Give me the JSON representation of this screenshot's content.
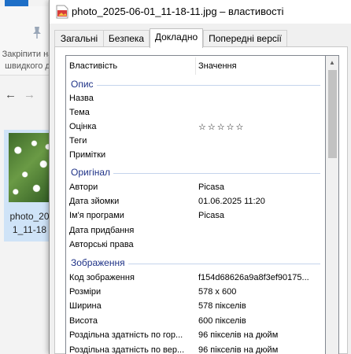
{
  "explorer": {
    "pin_text_line1": "Закріпити на",
    "pin_text_line2": "швидкого д",
    "back_arrow": "←",
    "forward_arrow": "→",
    "thumb_name_line1": "photo_20",
    "thumb_name_line2": "1_11-18"
  },
  "dialog": {
    "title": "photo_2025-06-01_11-18-11.jpg – властивості",
    "tabs": [
      {
        "label": "Загальні"
      },
      {
        "label": "Безпека"
      },
      {
        "label": "Докладно"
      },
      {
        "label": "Попередні версії"
      }
    ],
    "columns": {
      "property": "Властивість",
      "value": "Значення"
    },
    "groups": {
      "description": "Опис",
      "origin": "Оригінал",
      "image": "Зображення"
    },
    "description_rows": [
      {
        "key": "Назва",
        "value": ""
      },
      {
        "key": "Тема",
        "value": ""
      },
      {
        "key": "Оцінка",
        "value": "☆☆☆☆☆"
      },
      {
        "key": "Теги",
        "value": ""
      },
      {
        "key": "Примітки",
        "value": ""
      }
    ],
    "origin_rows": [
      {
        "key": "Автори",
        "value": "Picasa"
      },
      {
        "key": "Дата зйомки",
        "value": "01.06.2025 11:20"
      },
      {
        "key": "Ім'я програми",
        "value": "Picasa"
      },
      {
        "key": "Дата придбання",
        "value": ""
      },
      {
        "key": "Авторські права",
        "value": ""
      }
    ],
    "image_rows": [
      {
        "key": "Код зображення",
        "value": "f154d68626a9a8f3ef90175..."
      },
      {
        "key": "Розміри",
        "value": "578 x 600"
      },
      {
        "key": "Ширина",
        "value": "578 пікселів"
      },
      {
        "key": "Висота",
        "value": "600 пікселів"
      },
      {
        "key": "Роздільна здатність по гор...",
        "value": "96 пікселів на дюйм"
      },
      {
        "key": "Роздільна здатність по вер...",
        "value": "96 пікселів на дюйм"
      }
    ],
    "scroll_up_arrow": "▲"
  },
  "colors": {
    "group_title": "#1e3287",
    "group_line": "#c5d4ec",
    "selection": "#cfe3f7",
    "ribbon_accent": "#1e6fc7"
  }
}
